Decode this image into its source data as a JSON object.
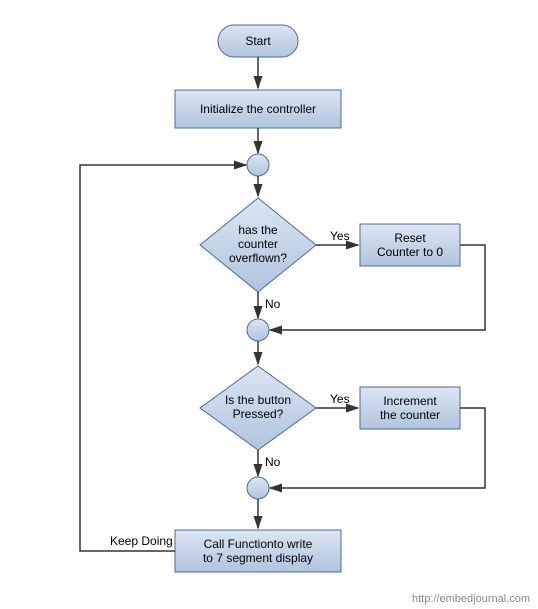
{
  "chart_data": {
    "type": "flowchart",
    "nodes": [
      {
        "id": "start",
        "type": "terminator",
        "label": "Start"
      },
      {
        "id": "init",
        "type": "process",
        "label": "Initialize the controller"
      },
      {
        "id": "c1",
        "type": "connector",
        "label": ""
      },
      {
        "id": "d1",
        "type": "decision",
        "label": "has the counter overflown?"
      },
      {
        "id": "reset",
        "type": "process",
        "label": "Reset Counter to 0"
      },
      {
        "id": "c2",
        "type": "connector",
        "label": ""
      },
      {
        "id": "d2",
        "type": "decision",
        "label": "Is the button Pressed?"
      },
      {
        "id": "inc",
        "type": "process",
        "label": "Increment the counter"
      },
      {
        "id": "c3",
        "type": "connector",
        "label": ""
      },
      {
        "id": "write",
        "type": "process",
        "label": "Call Functionto write to 7 segment display"
      }
    ],
    "edges": [
      {
        "from": "start",
        "to": "init"
      },
      {
        "from": "init",
        "to": "c1"
      },
      {
        "from": "c1",
        "to": "d1"
      },
      {
        "from": "d1",
        "to": "reset",
        "label": "Yes"
      },
      {
        "from": "d1",
        "to": "c2",
        "label": "No"
      },
      {
        "from": "reset",
        "to": "c2"
      },
      {
        "from": "c2",
        "to": "d2"
      },
      {
        "from": "d2",
        "to": "inc",
        "label": "Yes"
      },
      {
        "from": "d2",
        "to": "c3",
        "label": "No"
      },
      {
        "from": "inc",
        "to": "c3"
      },
      {
        "from": "c3",
        "to": "write"
      },
      {
        "from": "write",
        "to": "c1",
        "label": "Keep Doing"
      }
    ]
  },
  "labels": {
    "start": "Start",
    "init": "Initialize the controller",
    "d1_l1": "has the",
    "d1_l2": "counter",
    "d1_l3": "overflown?",
    "reset_l1": "Reset",
    "reset_l2": "Counter to 0",
    "d2_l1": "Is the button",
    "d2_l2": "Pressed?",
    "inc_l1": "Increment",
    "inc_l2": "the counter",
    "write_l1": "Call Functionto write",
    "write_l2": "to 7 segment display",
    "yes": "Yes",
    "no": "No",
    "keep": "Keep Doing",
    "watermark": "http://embedjournal.com"
  }
}
